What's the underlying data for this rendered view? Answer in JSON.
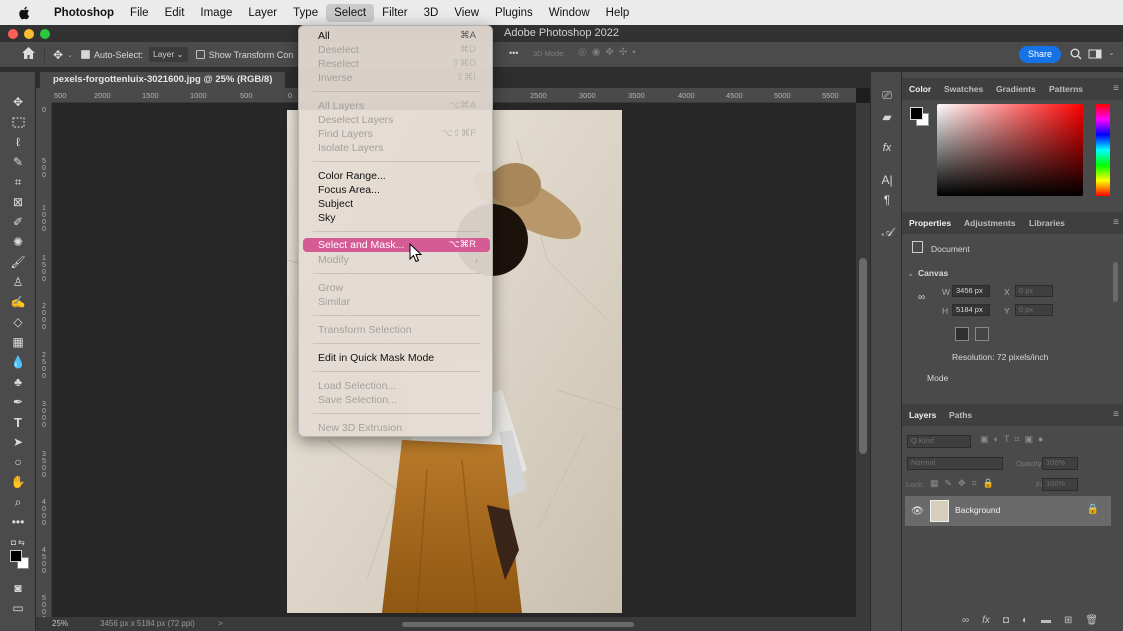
{
  "menubar": {
    "items": [
      "Photoshop",
      "File",
      "Edit",
      "Image",
      "Layer",
      "Type",
      "Select",
      "Filter",
      "3D",
      "View",
      "Plugins",
      "Window",
      "Help"
    ]
  },
  "window": {
    "title": "Adobe Photoshop 2022"
  },
  "options_bar": {
    "auto_select_label": "Auto-Select:",
    "auto_select_value": "Layer",
    "show_transform_label": "Show Transform Con",
    "mode_3d_label": "3D Mode:",
    "share_label": "Share"
  },
  "document": {
    "tab_title": "pexels-forgottenluix-3021600.jpg @ 25% (RGB/8)",
    "ruler_ticks": [
      "500",
      "2000",
      "1500",
      "1000",
      "500",
      "0",
      "2500",
      "3000",
      "3500",
      "4000",
      "4500",
      "5000",
      "5500"
    ],
    "ruler_v_ticks": [
      "0",
      "5\n0\n0",
      "1\n0\n0\n0",
      "1\n5\n0\n0",
      "2\n0\n0\n0",
      "2\n5\n0\n0",
      "3\n0\n0\n0",
      "3\n5\n0\n0",
      "4\n0\n0\n0",
      "4\n5\n0\n0",
      "5\n0\n0\n0"
    ]
  },
  "status": {
    "zoom": "25%",
    "dimensions": "3456 px x 5184 px (72 ppi)",
    "arrow": ">"
  },
  "select_menu": {
    "items": [
      {
        "label": "All",
        "shortcut": "⌘A",
        "disabled": false
      },
      {
        "label": "Deselect",
        "shortcut": "⌘D",
        "disabled": true
      },
      {
        "label": "Reselect",
        "shortcut": "⇧⌘D",
        "disabled": true
      },
      {
        "label": "Inverse",
        "shortcut": "⇧⌘I",
        "disabled": true
      },
      {
        "label": "All Layers",
        "shortcut": "⌥⌘A",
        "disabled": true
      },
      {
        "label": "Deselect Layers",
        "shortcut": "",
        "disabled": true
      },
      {
        "label": "Find Layers",
        "shortcut": "⌥⇧⌘F",
        "disabled": true
      },
      {
        "label": "Isolate Layers",
        "shortcut": "",
        "disabled": true
      },
      {
        "label": "Color Range...",
        "shortcut": "",
        "disabled": false
      },
      {
        "label": "Focus Area...",
        "shortcut": "",
        "disabled": false
      },
      {
        "label": "Subject",
        "shortcut": "",
        "disabled": false
      },
      {
        "label": "Sky",
        "shortcut": "",
        "disabled": false
      },
      {
        "label": "Select and Mask...",
        "shortcut": "⌥⌘R",
        "disabled": false,
        "highlighted": true
      },
      {
        "label": "Modify",
        "shortcut": "",
        "disabled": true,
        "submenu": true
      },
      {
        "label": "Grow",
        "shortcut": "",
        "disabled": true
      },
      {
        "label": "Similar",
        "shortcut": "",
        "disabled": true
      },
      {
        "label": "Transform Selection",
        "shortcut": "",
        "disabled": true
      },
      {
        "label": "Edit in Quick Mask Mode",
        "shortcut": "",
        "disabled": false
      },
      {
        "label": "Load Selection...",
        "shortcut": "",
        "disabled": true
      },
      {
        "label": "Save Selection...",
        "shortcut": "",
        "disabled": true
      },
      {
        "label": "New 3D Extrusion",
        "shortcut": "",
        "disabled": true
      }
    ]
  },
  "color_panel": {
    "tabs": [
      "Color",
      "Swatches",
      "Gradients",
      "Patterns"
    ]
  },
  "properties_panel": {
    "tabs": [
      "Properties",
      "Adjustments",
      "Libraries"
    ],
    "doc_label": "Document",
    "canvas_label": "Canvas",
    "w_label": "W",
    "w_value": "3456 px",
    "h_label": "H",
    "h_value": "5184 px",
    "x_label": "X",
    "x_value": "0 px",
    "y_label": "Y",
    "y_value": "0 px",
    "resolution": "Resolution: 72 pixels/inch",
    "mode_label": "Mode"
  },
  "layers_panel": {
    "tabs": [
      "Layers",
      "Paths"
    ],
    "kind_placeholder": "Q Kind",
    "blend_mode": "Normal",
    "opacity_label": "Opacity:",
    "opacity_value": "100%",
    "lock_label": "Lock:",
    "fill_label": "Fill:",
    "fill_value": "100%",
    "layer_name": "Background"
  },
  "colors": {
    "share_blue": "#1473e6",
    "menu_highlight": "#d55b94",
    "traffic_red": "#ff5f57",
    "traffic_yellow": "#febc2e",
    "traffic_green": "#28c840"
  }
}
